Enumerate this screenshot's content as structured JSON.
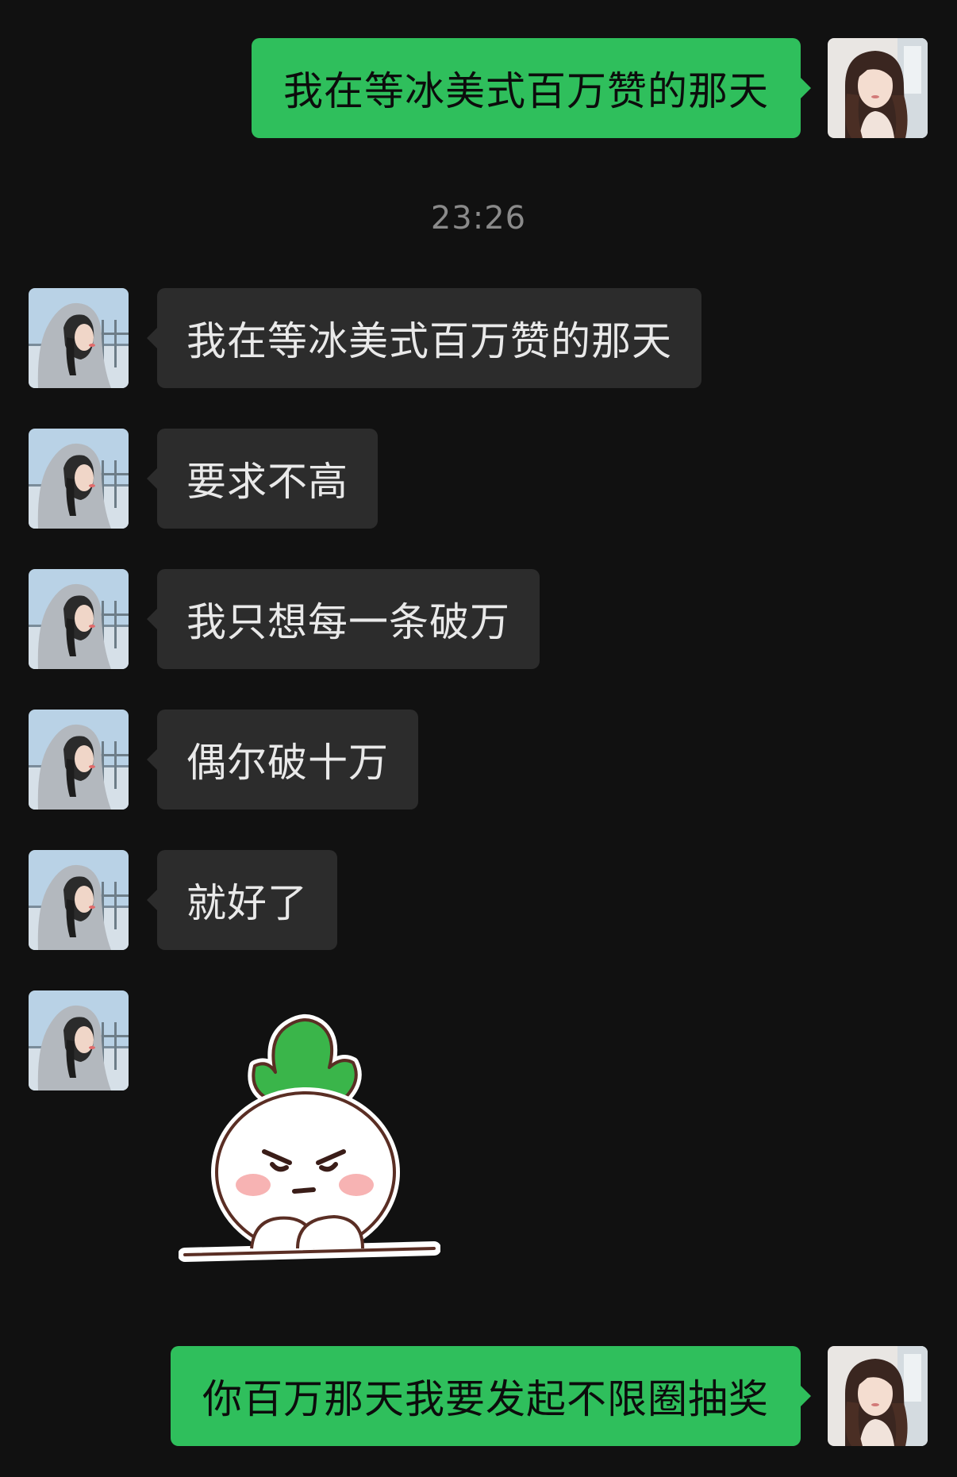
{
  "colors": {
    "background": "#111111",
    "outgoing_bubble": "#2fbf5c",
    "incoming_bubble": "#2c2c2c",
    "timestamp_text": "#8a8a8a"
  },
  "messages": {
    "out_1": "我在等冰美式百万赞的那天",
    "timestamp": "23:26",
    "in_1": "我在等冰美式百万赞的那天",
    "in_2": "要求不高",
    "in_3": "我只想每一条破万",
    "in_4": "偶尔破十万",
    "in_5": "就好了",
    "in_6_sticker": "radish-sticker-icon",
    "out_2": "你百万那天我要发起不限圈抽奖"
  }
}
